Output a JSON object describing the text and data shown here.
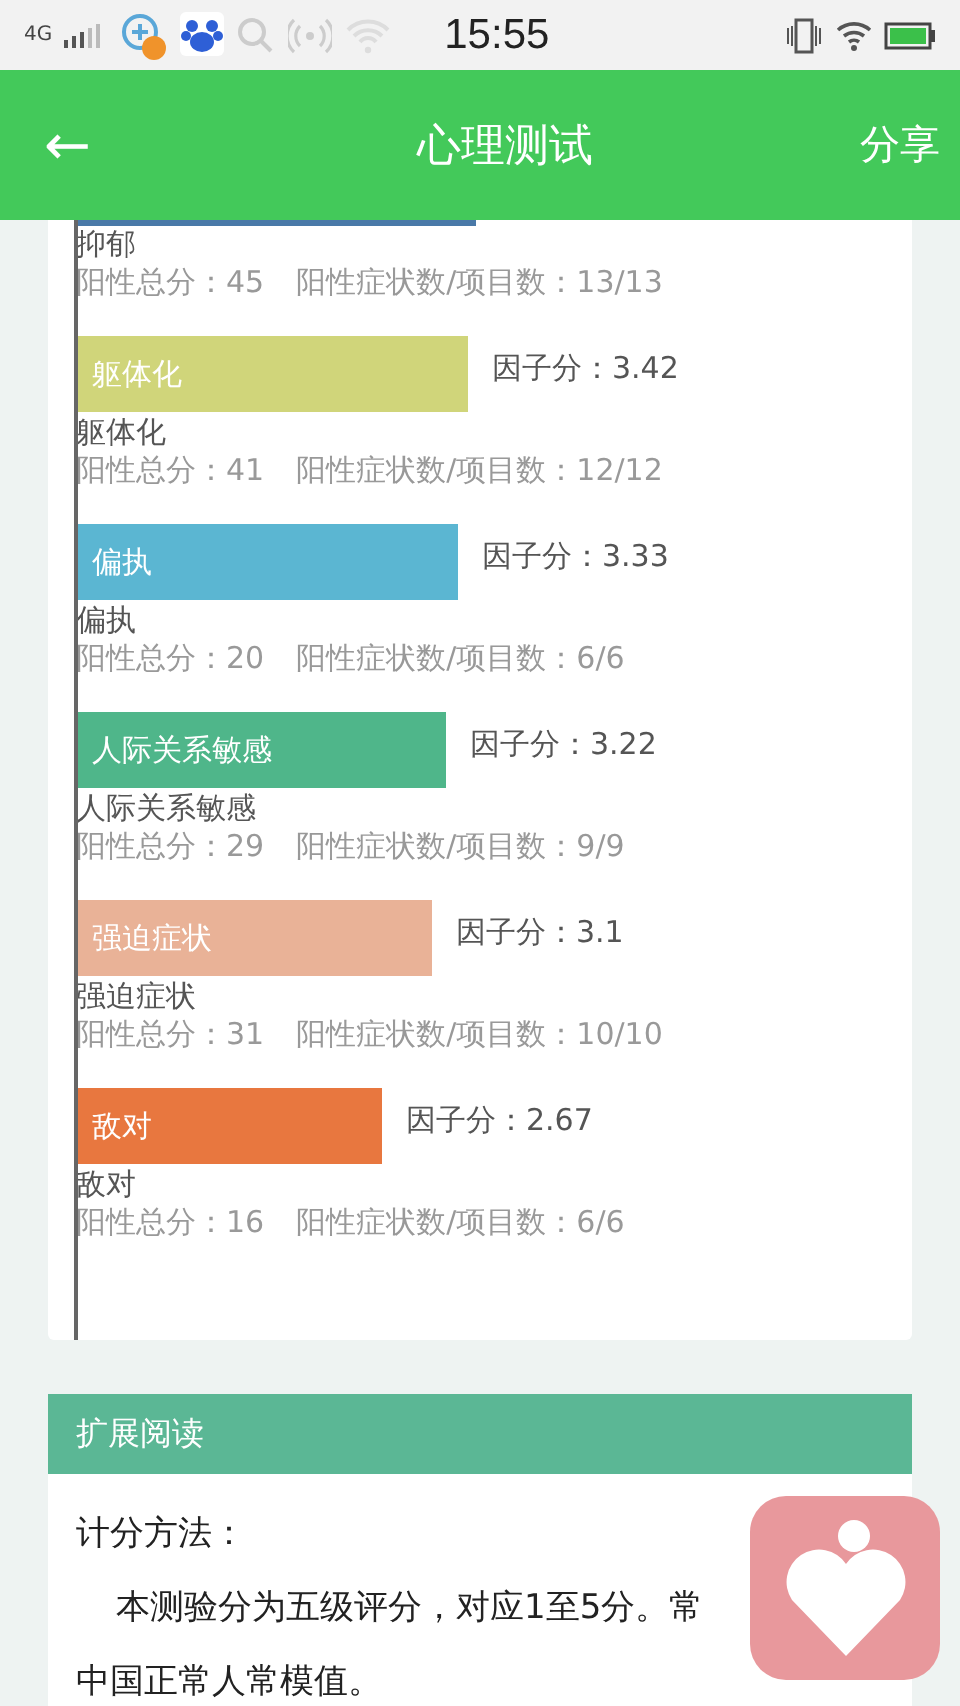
{
  "status_bar": {
    "network": "4G",
    "time": "15:55"
  },
  "header": {
    "back": "←",
    "title": "心理测试",
    "share": "分享"
  },
  "factors": [
    {
      "kind": "cut",
      "name": "抑郁",
      "total": "阳性总分：45",
      "count": "阳性症状数/项目数：13/13",
      "color": "#4a79a8"
    },
    {
      "kind": "full",
      "bar_label": "躯体化",
      "score": "因子分：3.42",
      "name": "躯体化",
      "total": "阳性总分：41",
      "count": "阳性症状数/项目数：12/12",
      "color": "#d0d57a"
    },
    {
      "kind": "full",
      "bar_label": "偏执",
      "score": "因子分：3.33",
      "name": "偏执",
      "total": "阳性总分：20",
      "count": "阳性症状数/项目数：6/6",
      "color": "#5bb6d2"
    },
    {
      "kind": "full",
      "bar_label": "人际关系敏感",
      "score": "因子分：3.22",
      "name": "人际关系敏感",
      "total": "阳性总分：29",
      "count": "阳性症状数/项目数：9/9",
      "color": "#4fb68a"
    },
    {
      "kind": "full",
      "bar_label": "强迫症状",
      "score": "因子分：3.1",
      "name": "强迫症状",
      "total": "阳性总分：31",
      "count": "阳性症状数/项目数：10/10",
      "color": "#e9b297"
    },
    {
      "kind": "full",
      "bar_label": "敌对",
      "score": "因子分：2.67",
      "name": "敌对",
      "total": "阳性总分：16",
      "count": "阳性症状数/项目数：6/6",
      "color": "#e8773f"
    }
  ],
  "reading": {
    "title": "扩展阅读",
    "heading": "计分方法：",
    "lines": [
      "本测验分为五级评分，对应1至5分。常",
      "中国正常人常模值。"
    ]
  }
}
